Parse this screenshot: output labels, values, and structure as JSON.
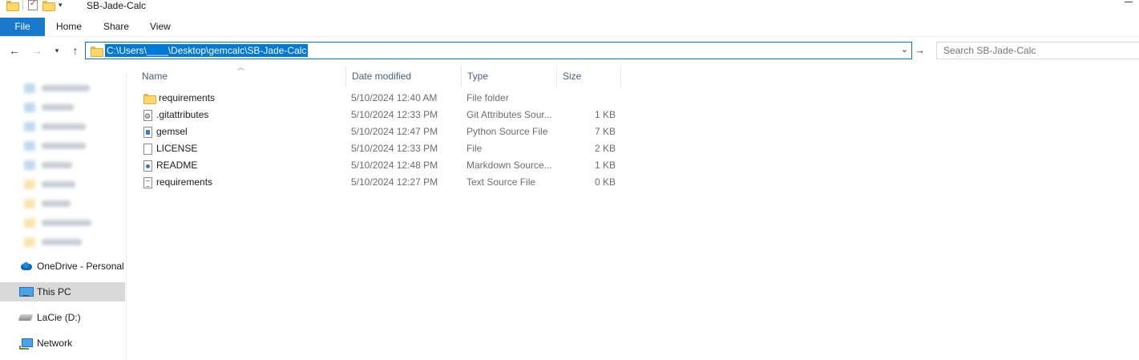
{
  "window": {
    "title": "SB-Jade-Calc"
  },
  "ribbon": {
    "tabs": [
      "File",
      "Home",
      "Share",
      "View"
    ]
  },
  "address": {
    "path": "C:\\Users\\____\\Desktop\\gemcalc\\SB-Jade-Calc"
  },
  "search": {
    "placeholder": "Search SB-Jade-Calc"
  },
  "navpane": {
    "items": [
      {
        "label": "OneDrive - Personal",
        "icon": "onedrive-cloud-icon"
      },
      {
        "label": "This PC",
        "icon": "computer-icon",
        "selected": true
      },
      {
        "label": "LaCie (D:)",
        "icon": "drive-icon"
      },
      {
        "label": "Network",
        "icon": "network-icon"
      }
    ]
  },
  "columns": {
    "name": "Name",
    "date": "Date modified",
    "type": "Type",
    "size": "Size"
  },
  "files": [
    {
      "name": "requirements",
      "date": "5/10/2024 12:40 AM",
      "type": "File folder",
      "size": "",
      "icon": "folder-icon"
    },
    {
      "name": ".gitattributes",
      "date": "5/10/2024 12:33 PM",
      "type": "Git Attributes Sour...",
      "size": "1 KB",
      "icon": "gitattributes-file-icon"
    },
    {
      "name": "gemsel",
      "date": "5/10/2024 12:47 PM",
      "type": "Python Source File",
      "size": "7 KB",
      "icon": "python-file-icon"
    },
    {
      "name": "LICENSE",
      "date": "5/10/2024 12:33 PM",
      "type": "File",
      "size": "2 KB",
      "icon": "generic-file-icon"
    },
    {
      "name": "README",
      "date": "5/10/2024 12:48 PM",
      "type": "Markdown Source...",
      "size": "1 KB",
      "icon": "markdown-file-icon"
    },
    {
      "name": "requirements",
      "date": "5/10/2024 12:27 PM",
      "type": "Text Source File",
      "size": "0 KB",
      "icon": "text-file-icon"
    }
  ],
  "colors": {
    "accent": "#0078d7",
    "file_tab": "#1979ca",
    "selected_row": "#d9d9d9",
    "header_text": "#4c607a"
  }
}
